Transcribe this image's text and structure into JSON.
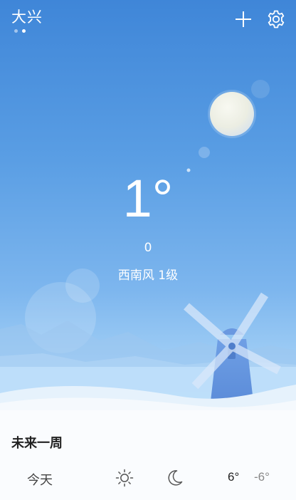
{
  "header": {
    "city": "大兴",
    "page_count": 2,
    "active_page": 1,
    "add_icon": "plus-icon",
    "settings_icon": "gear-icon"
  },
  "current": {
    "temperature": "1°",
    "value": "0",
    "wind": "西南风 1级"
  },
  "forecast": {
    "title": "未来一周",
    "days": [
      {
        "label": "今天",
        "day_icon": "sun-icon",
        "night_icon": "moon-icon",
        "high": "6°",
        "low": "-6°"
      }
    ]
  },
  "colors": {
    "sky_top": "#3f86d8",
    "sky_bottom": "#cde7fb",
    "panel": "#fafcfe",
    "text_dark": "#222222",
    "text_muted": "#888888"
  }
}
